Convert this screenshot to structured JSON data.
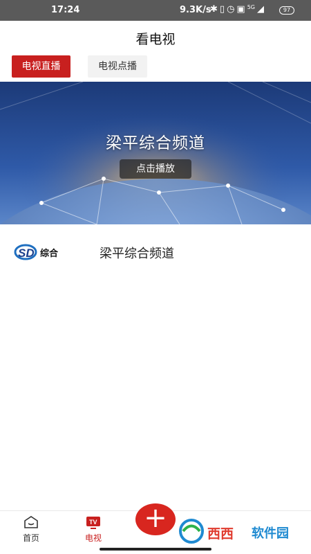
{
  "status_bar": {
    "time": "17:24",
    "network_speed": "9.3K/s",
    "battery": "97",
    "icons": [
      "bluetooth-icon",
      "vibrate-icon",
      "alarm-icon",
      "nfc-icon",
      "signal-5g-icon",
      "signal-icon"
    ]
  },
  "header": {
    "title": "看电视"
  },
  "tabs": [
    {
      "label": "电视直播",
      "active": true
    },
    {
      "label": "电视点播",
      "active": false
    }
  ],
  "banner": {
    "channel_title": "梁平综合频道",
    "play_label": "点击播放"
  },
  "channels": [
    {
      "logo_text": "综合",
      "name": "梁平综合频道"
    }
  ],
  "bottom_nav": {
    "items": [
      {
        "label": "首页",
        "icon": "home-icon",
        "active": false
      },
      {
        "label": "电视",
        "icon": "tv-icon",
        "active": true
      }
    ],
    "add_icon": "plus-icon",
    "watermark_text_1": "西西",
    "watermark_text_2": "软件园"
  },
  "colors": {
    "accent": "#c8201f",
    "status_bar_bg": "#5a5a5a"
  }
}
